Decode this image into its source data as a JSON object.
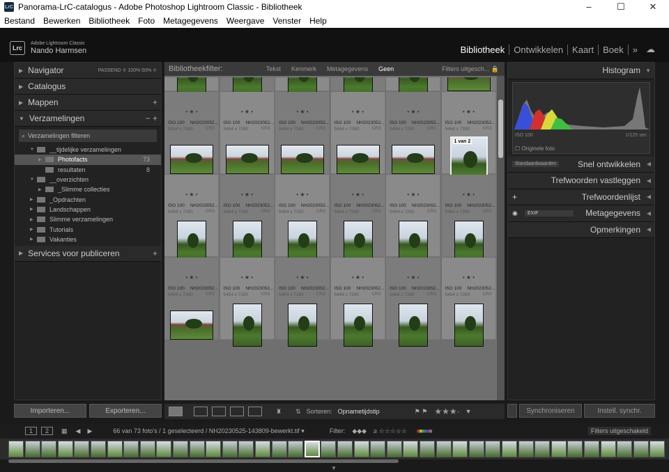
{
  "window": {
    "title": "Panorama-LrC-catalogus - Adobe Photoshop Lightroom Classic - Bibliotheek",
    "app_icon": "LrC"
  },
  "menu": [
    "Bestand",
    "Bewerken",
    "Bibliotheek",
    "Foto",
    "Metagegevens",
    "Weergave",
    "Venster",
    "Help"
  ],
  "identity": {
    "logo": "Lrc",
    "product": "Adobe Lightroom Classic",
    "user": "Nando Harmsen"
  },
  "modules": [
    "Bibliotheek",
    "Ontwikkelen",
    "Kaart",
    "Boek",
    "»"
  ],
  "left": {
    "navigator": "Navigator",
    "nav_opts": "PASSEND ≑   100%     50% ≑",
    "catalogus": "Catalogus",
    "mappen": "Mappen",
    "verzamelingen": "Verzamelingen",
    "filter": "Verzamelingen filteren",
    "collections": [
      {
        "label": "__tijdelijke verzamelingen",
        "count": ""
      },
      {
        "label": "Photofacts",
        "count": "73"
      },
      {
        "label": "resultaten",
        "count": "8"
      },
      {
        "label": "__overzichten",
        "count": ""
      },
      {
        "label": "_Slimme collecties",
        "count": ""
      },
      {
        "label": "_Opdrachten",
        "count": ""
      },
      {
        "label": "Landschappen",
        "count": ""
      },
      {
        "label": "Slimme verzamelingen",
        "count": ""
      },
      {
        "label": "Tutorials",
        "count": ""
      },
      {
        "label": "Vakanties",
        "count": ""
      }
    ],
    "publish": "Services voor publiceren",
    "import_btn": "Importeren...",
    "export_btn": "Exporteren..."
  },
  "filterbar": {
    "title": "Bibliotheekfilter:",
    "options": [
      "Tekst",
      "Kenmerk",
      "Metagegevens",
      "Geen"
    ],
    "right": "Filters uitgesch..."
  },
  "grid": {
    "meta": [
      "ISO 100",
      "NH2023052...",
      "5464 x 7280",
      "CR3"
    ],
    "stack_badge": "1 van 2"
  },
  "toolbar": {
    "sort_label": "Sorteren:",
    "sort_value": "Opnametijdstip"
  },
  "right": {
    "histogram": "Histogram",
    "iso": "ISO 100",
    "shutter": "1/125 sec",
    "original": "Originele foto",
    "preset": "Standaardwaarden",
    "quick": "Snel ontwikkelen",
    "keywording": "Trefwoorden vastleggen",
    "keywordlist": "Trefwoordenlijst",
    "metadata": "Metagegevens",
    "exif": "EXIF",
    "comments": "Opmerkingen",
    "sync": "Synchroniseren",
    "sync_settings": "Instell. synchr."
  },
  "filmbar": {
    "info": "66 van 73 foto's / 1 geselecteerd / NH20230525-143809-bewerkt.tif ▾",
    "filter": "Filter:",
    "filter_state": "Filters uitgeschakeld"
  }
}
